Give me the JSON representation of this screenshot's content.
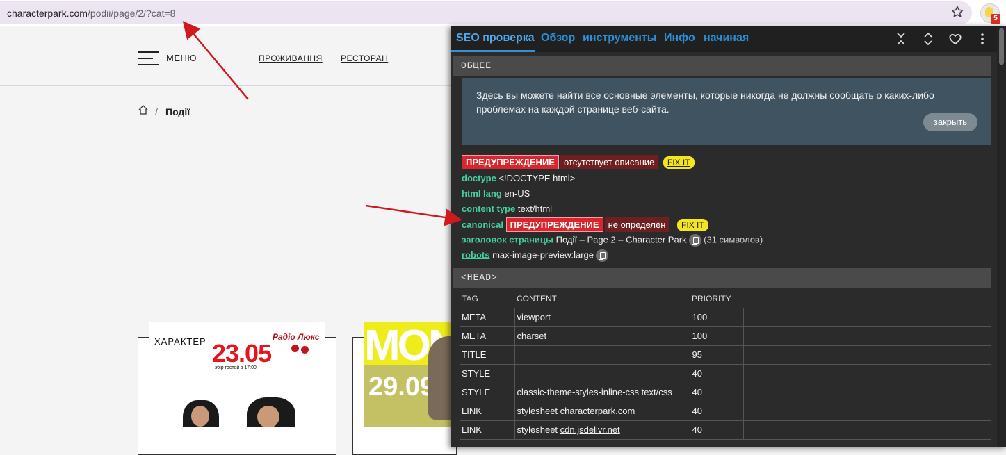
{
  "browser": {
    "url_domain": "characterpark.com",
    "url_path": "/podii/page/2/?cat=8",
    "extension_badge": "5"
  },
  "site": {
    "menu_label": "МЕНЮ",
    "nav": [
      "ПРОЖИВАННЯ",
      "РЕСТОРАН"
    ],
    "breadcrumb_sep": "/",
    "breadcrumb_current": "Події",
    "poster1": {
      "brand": "ХАРАКТЕР",
      "date": "23.05",
      "sub": "збір гостей з 17:00",
      "radio": "Радіо Люкс"
    },
    "poster2": {
      "title": "MON",
      "date": "29.09"
    }
  },
  "panel": {
    "tabs": [
      "SEO проверка",
      "Обзор",
      "инструменты",
      "Инфо",
      "начиная"
    ],
    "toolbar_icons": [
      "collapse-icon",
      "expand-icon",
      "heart-icon",
      "more-vert-icon"
    ],
    "general_title": "ОБЩЕЕ",
    "info_text": "Здесь вы можете найти все основные элементы, которые никогда не должны сообщать о каких-либо проблемах на каждой странице веб-сайта.",
    "close_label": "закрыть",
    "warning_label": "ПРЕДУПРЕЖДЕНИЕ",
    "missing_description": "отсутствует описание",
    "fix_it": "FIX IT",
    "doctype_key": "doctype",
    "doctype_val": "<!DOCTYPE html>",
    "htmllang_key": "html lang",
    "htmllang_val": "en-US",
    "contenttype_key": "content type",
    "contenttype_val": "text/html",
    "canonical_key": "canonical",
    "canonical_msg": "не определён",
    "title_key": "заголовок страницы",
    "title_val": "Події – Page 2 – Character Park",
    "title_count": "(31 символов)",
    "robots_key": "robots",
    "robots_val": "max-image-preview:large",
    "head_title": "<HEAD>",
    "table": {
      "headers": [
        "TAG",
        "CONTENT",
        "PRIORITY"
      ],
      "rows": [
        {
          "tag": "META",
          "content": "viewport",
          "link": "",
          "priority": "100"
        },
        {
          "tag": "META",
          "content": "charset",
          "link": "",
          "priority": "100"
        },
        {
          "tag": "TITLE",
          "content": "",
          "link": "",
          "priority": "95"
        },
        {
          "tag": "STYLE",
          "content": "",
          "link": "",
          "priority": "40"
        },
        {
          "tag": "STYLE",
          "content": "classic-theme-styles-inline-css text/css",
          "link": "",
          "priority": "40"
        },
        {
          "tag": "LINK",
          "content": "stylesheet",
          "link": "characterpark.com",
          "priority": "40"
        },
        {
          "tag": "LINK",
          "content": "stylesheet",
          "link": "cdn.jsdelivr.net",
          "priority": "40"
        }
      ]
    }
  },
  "colors": {
    "warning_red": "#d9262c",
    "key_green": "#45d0a0",
    "fixit_yellow": "#f4e61c",
    "tab_blue": "#2b8fd6",
    "arrow_red": "#d0181e"
  }
}
